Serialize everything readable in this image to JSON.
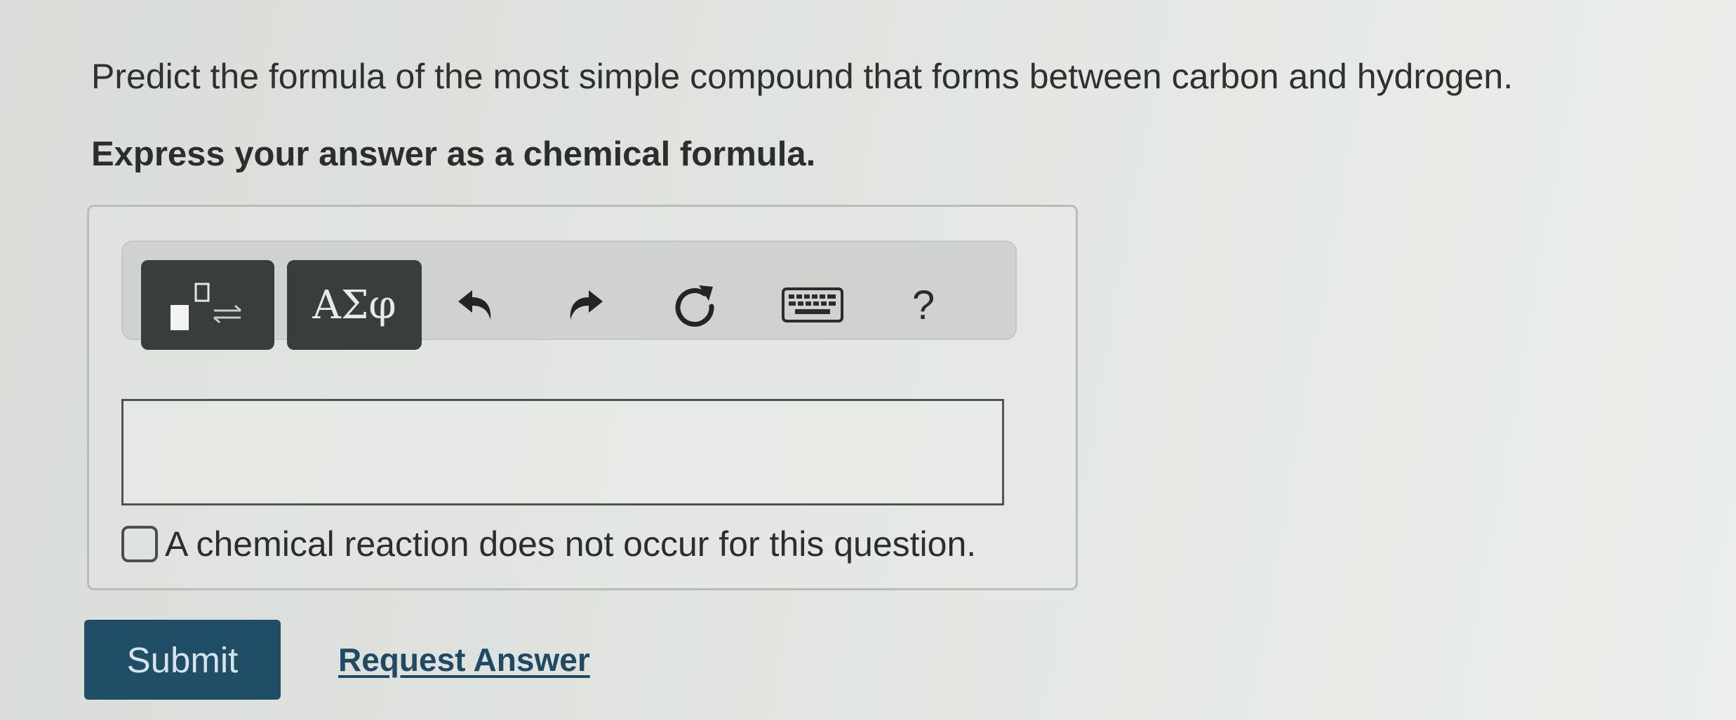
{
  "question": {
    "prompt": "Predict the formula of the most simple compound that forms between carbon and hydrogen.",
    "instruction": "Express your answer as a chemical formula."
  },
  "toolbar": {
    "symbols_label": "ΑΣφ",
    "help_label": "?",
    "icons": {
      "templates": "template-arrows-icon",
      "undo": "undo-icon",
      "redo": "redo-icon",
      "reset": "reset-icon",
      "keyboard": "keyboard-icon"
    }
  },
  "answer": {
    "value": "",
    "no_reaction_label": "A chemical reaction does not occur for this question.",
    "no_reaction_checked": false
  },
  "actions": {
    "submit_label": "Submit",
    "request_answer_label": "Request Answer"
  },
  "colors": {
    "submit_bg": "#1f4e66",
    "link": "#1f4a63",
    "toolbar_dark": "#3a3d3e"
  }
}
